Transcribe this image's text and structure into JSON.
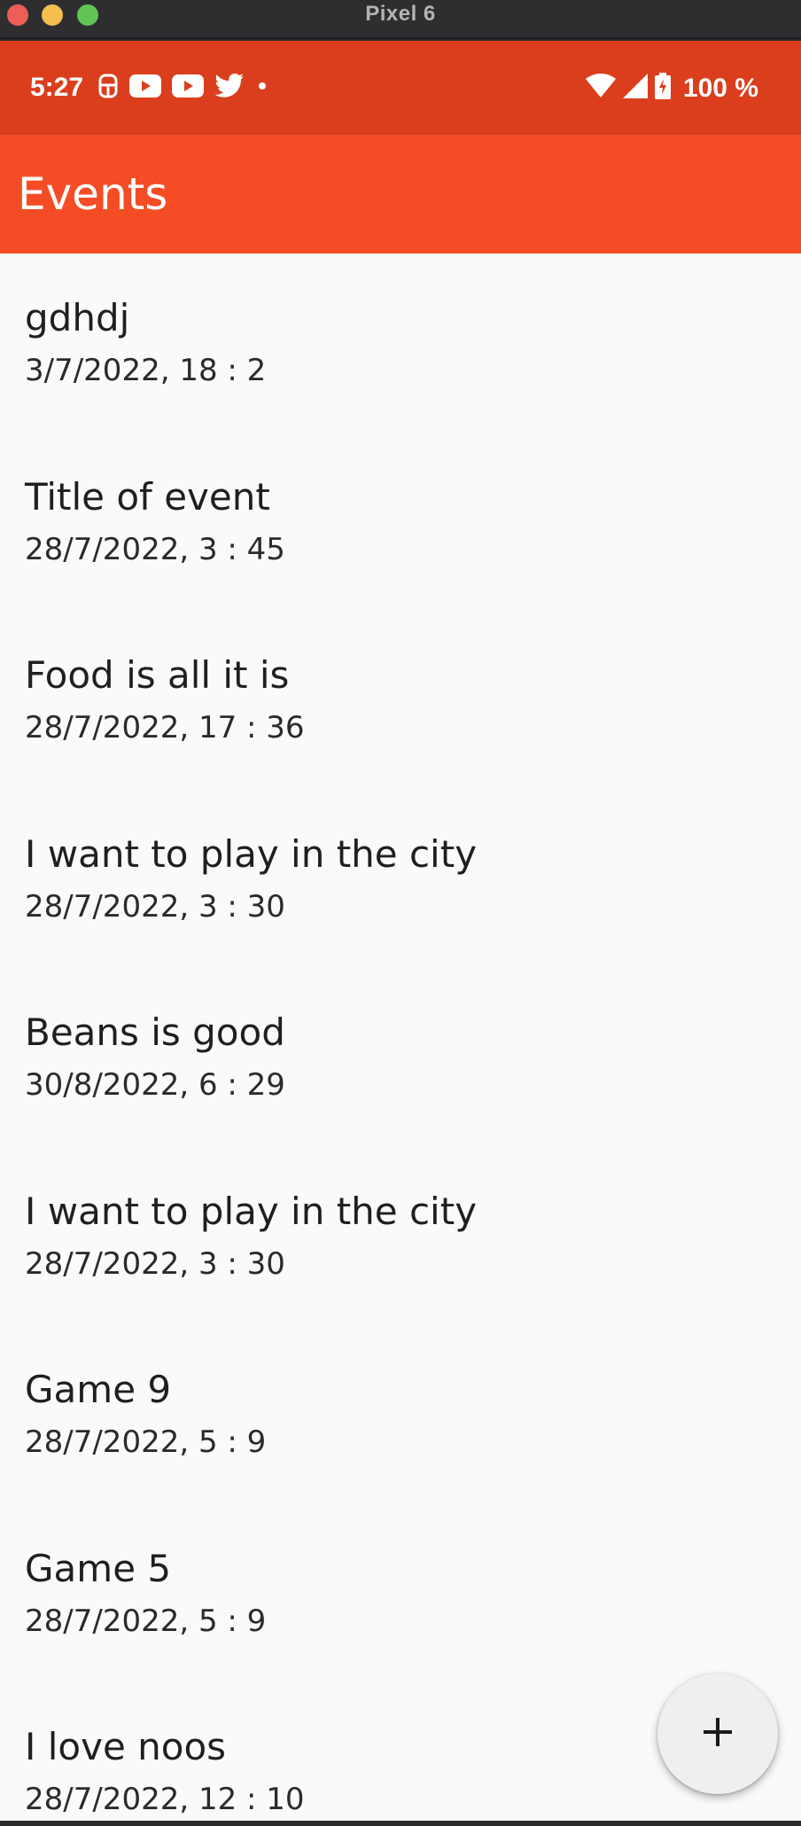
{
  "window": {
    "title": "Pixel 6"
  },
  "status_bar": {
    "time": "5:27",
    "left_icons": [
      "notification-icon",
      "youtube-icon",
      "youtube-icon",
      "twitter-icon",
      "dot-icon"
    ],
    "right_icons": [
      "wifi-icon",
      "signal-icon",
      "battery-charging-icon"
    ],
    "battery": "100 %"
  },
  "app_bar": {
    "title": "Events"
  },
  "events": [
    {
      "title": "gdhdj",
      "date": "3/7/2022, 18 : 2"
    },
    {
      "title": "Title of event",
      "date": "28/7/2022, 3 : 45"
    },
    {
      "title": "Food is all it is",
      "date": "28/7/2022, 17 : 36"
    },
    {
      "title": "I want to play in the city",
      "date": "28/7/2022, 3 : 30"
    },
    {
      "title": "Beans is good",
      "date": "30/8/2022, 6 : 29"
    },
    {
      "title": "I want to play in the city",
      "date": "28/7/2022, 3 : 30"
    },
    {
      "title": "Game 9",
      "date": "28/7/2022, 5 : 9"
    },
    {
      "title": "Game 5",
      "date": "28/7/2022, 5 : 9"
    },
    {
      "title": "I love noos",
      "date": "28/7/2022, 12 : 10"
    }
  ],
  "fab": {
    "icon": "add-icon"
  },
  "colors": {
    "status_bar": "#db3e1d",
    "app_bar": "#f44d25",
    "background": "#fafafa",
    "fab": "#efefef"
  }
}
